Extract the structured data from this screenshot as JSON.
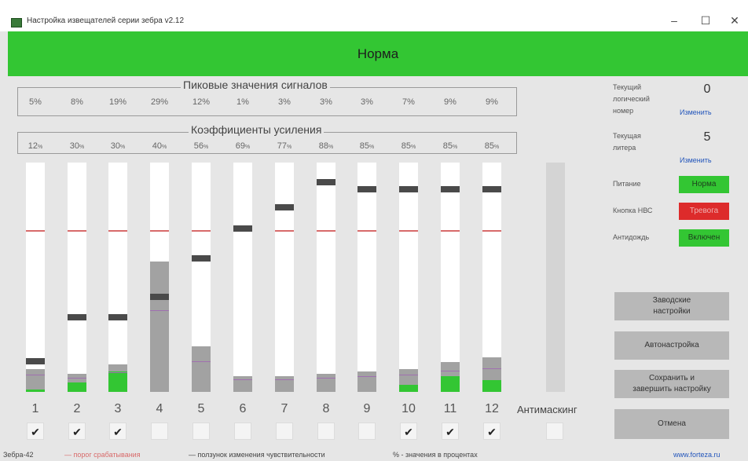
{
  "window": {
    "title": "Настройка извещателей серии зебра v2.12",
    "minimize_glyph": "–",
    "maximize_glyph": "☐",
    "close_glyph": "✕"
  },
  "status": {
    "text": "Норма",
    "color": "#33c633"
  },
  "peaks": {
    "title": "Пиковые значения сигналов",
    "values": [
      "5%",
      "8%",
      "19%",
      "29%",
      "12%",
      "1%",
      "3%",
      "3%",
      "3%",
      "7%",
      "9%",
      "9%"
    ]
  },
  "gains": {
    "title": "Коэффициенты усиления",
    "values": [
      "12",
      "30",
      "30",
      "40",
      "56",
      "69",
      "77",
      "88",
      "85",
      "85",
      "85",
      "85"
    ],
    "unit": "%"
  },
  "channels": {
    "numbers": [
      "1",
      "2",
      "3",
      "4",
      "5",
      "6",
      "7",
      "8",
      "9",
      "10",
      "11",
      "12"
    ],
    "checked": [
      true,
      true,
      true,
      false,
      false,
      false,
      false,
      false,
      false,
      true,
      true,
      true
    ],
    "check_glyph": "✔",
    "gray_pct": [
      10,
      8,
      12,
      57,
      20,
      7,
      7,
      8,
      9,
      10,
      13,
      15
    ],
    "green_pct": [
      1,
      4,
      9,
      0,
      0,
      0,
      0,
      0,
      0,
      3,
      7,
      5
    ],
    "threshold_pct": [
      70,
      70,
      70,
      70,
      70,
      70,
      70,
      70,
      70,
      70,
      70,
      70
    ],
    "sensitivity_pct": [
      12,
      31,
      31,
      40,
      57,
      70,
      79,
      90,
      87,
      87,
      87,
      87
    ]
  },
  "antimasking": {
    "label": "Антимаскинг",
    "checked": false
  },
  "info": {
    "logical_number_label": "Текущий\nлогический\nномер",
    "logical_number_value": "0",
    "logical_number_change": "Изменить",
    "litera_label": "Текущая\nлитера",
    "litera_value": "5",
    "litera_change": "Изменить",
    "power_label": "Питание",
    "power_status": "Норма",
    "nvs_button_label": "Кнопка НВС",
    "nvs_status": "Тревога",
    "anti_rain_label": "Антидождь",
    "anti_rain_status": "Включен"
  },
  "buttons": {
    "factory": "Заводские\nнастройки",
    "autotune": "Автонастройка",
    "save": "Сохранить и\nзавершить настройку",
    "cancel": "Отмена"
  },
  "legend": {
    "device": "Зебра-42",
    "threshold": "— порог срабатывания",
    "sensitivity": "— ползунок изменения чувствительности",
    "percent_note": "% - значения в процентах",
    "website": "www.forteza.ru"
  },
  "colors": {
    "ok_green": "#33c633",
    "alarm_red": "#dd2b2b",
    "threshold_line": "#d86a6a",
    "link_blue": "#2255bb"
  }
}
